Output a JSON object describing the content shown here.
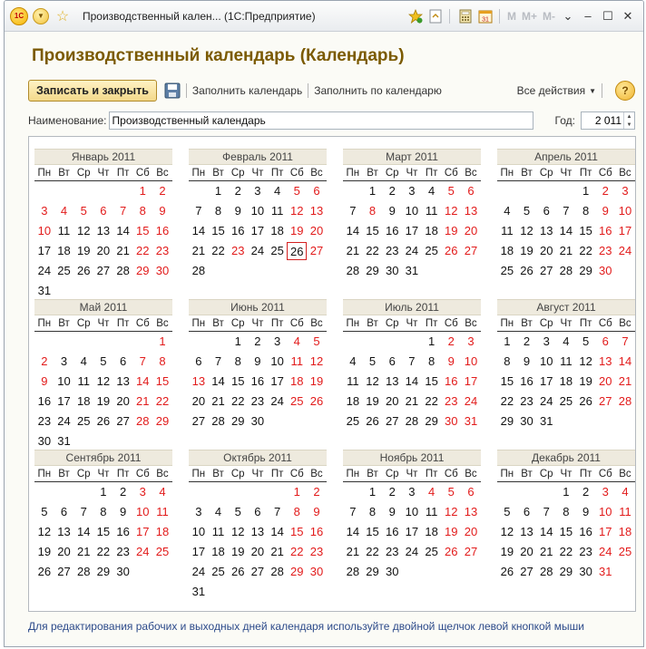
{
  "window": {
    "title": "Производственный кален... (1С:Предприятие)",
    "logo": "1C",
    "memory_buttons": [
      "M",
      "M+",
      "M-"
    ]
  },
  "form": {
    "title": "Производственный календарь (Календарь)",
    "toolbar": {
      "save_close": "Записать и закрыть",
      "fill_calendar": "Заполнить календарь",
      "fill_by_calendar": "Заполнить по календарю",
      "all_actions": "Все действия",
      "help": "?"
    },
    "name_label": "Наименование:",
    "name_value": "Производственный календарь",
    "year_label": "Год:",
    "year_value": "2 011"
  },
  "weekdays": [
    "Пн",
    "Вт",
    "Ср",
    "Чт",
    "Пт",
    "Сб",
    "Вс"
  ],
  "months": [
    {
      "name": "Январь 2011",
      "offset": 5,
      "days": 31,
      "holidays": [
        1,
        2,
        3,
        4,
        5,
        6,
        7,
        8,
        9,
        10,
        15,
        16,
        22,
        23,
        29,
        30
      ],
      "today": null
    },
    {
      "name": "Февраль 2011",
      "offset": 1,
      "days": 28,
      "holidays": [
        5,
        6,
        12,
        13,
        19,
        20,
        23,
        27
      ],
      "today": 26
    },
    {
      "name": "Март 2011",
      "offset": 1,
      "days": 31,
      "holidays": [
        5,
        6,
        8,
        12,
        13,
        19,
        20,
        26,
        27
      ],
      "today": null
    },
    {
      "name": "Апрель 2011",
      "offset": 4,
      "days": 30,
      "holidays": [
        2,
        3,
        9,
        10,
        16,
        17,
        23,
        24,
        30
      ],
      "today": null
    },
    {
      "name": "Май 2011",
      "offset": 6,
      "days": 31,
      "holidays": [
        1,
        2,
        7,
        8,
        9,
        14,
        15,
        21,
        22,
        28,
        29
      ],
      "today": null
    },
    {
      "name": "Июнь 2011",
      "offset": 2,
      "days": 30,
      "holidays": [
        4,
        5,
        11,
        12,
        13,
        18,
        19,
        25,
        26
      ],
      "today": null
    },
    {
      "name": "Июль 2011",
      "offset": 4,
      "days": 31,
      "holidays": [
        2,
        3,
        9,
        10,
        16,
        17,
        23,
        24,
        30,
        31
      ],
      "today": null
    },
    {
      "name": "Август 2011",
      "offset": 0,
      "days": 31,
      "holidays": [
        6,
        7,
        13,
        14,
        20,
        21,
        27,
        28
      ],
      "today": null
    },
    {
      "name": "Сентябрь 2011",
      "offset": 3,
      "days": 30,
      "holidays": [
        3,
        4,
        10,
        11,
        17,
        18,
        24,
        25
      ],
      "today": null
    },
    {
      "name": "Октябрь 2011",
      "offset": 5,
      "days": 31,
      "holidays": [
        1,
        2,
        8,
        9,
        15,
        16,
        22,
        23,
        29,
        30
      ],
      "today": null
    },
    {
      "name": "Ноябрь 2011",
      "offset": 1,
      "days": 30,
      "holidays": [
        4,
        5,
        6,
        12,
        13,
        19,
        20,
        26,
        27
      ],
      "today": null
    },
    {
      "name": "Декабрь 2011",
      "offset": 3,
      "days": 31,
      "holidays": [
        3,
        4,
        10,
        11,
        17,
        18,
        24,
        25,
        31
      ],
      "today": null
    }
  ],
  "hint": "Для редактирования рабочих и выходных дней календаря используйте двойной щелчок левой кнопкой мыши",
  "colors": {
    "holiday": "#e21b1b",
    "title": "#7b5a00",
    "primary_button": "#f3d98a",
    "hint": "#2c4a8a"
  }
}
